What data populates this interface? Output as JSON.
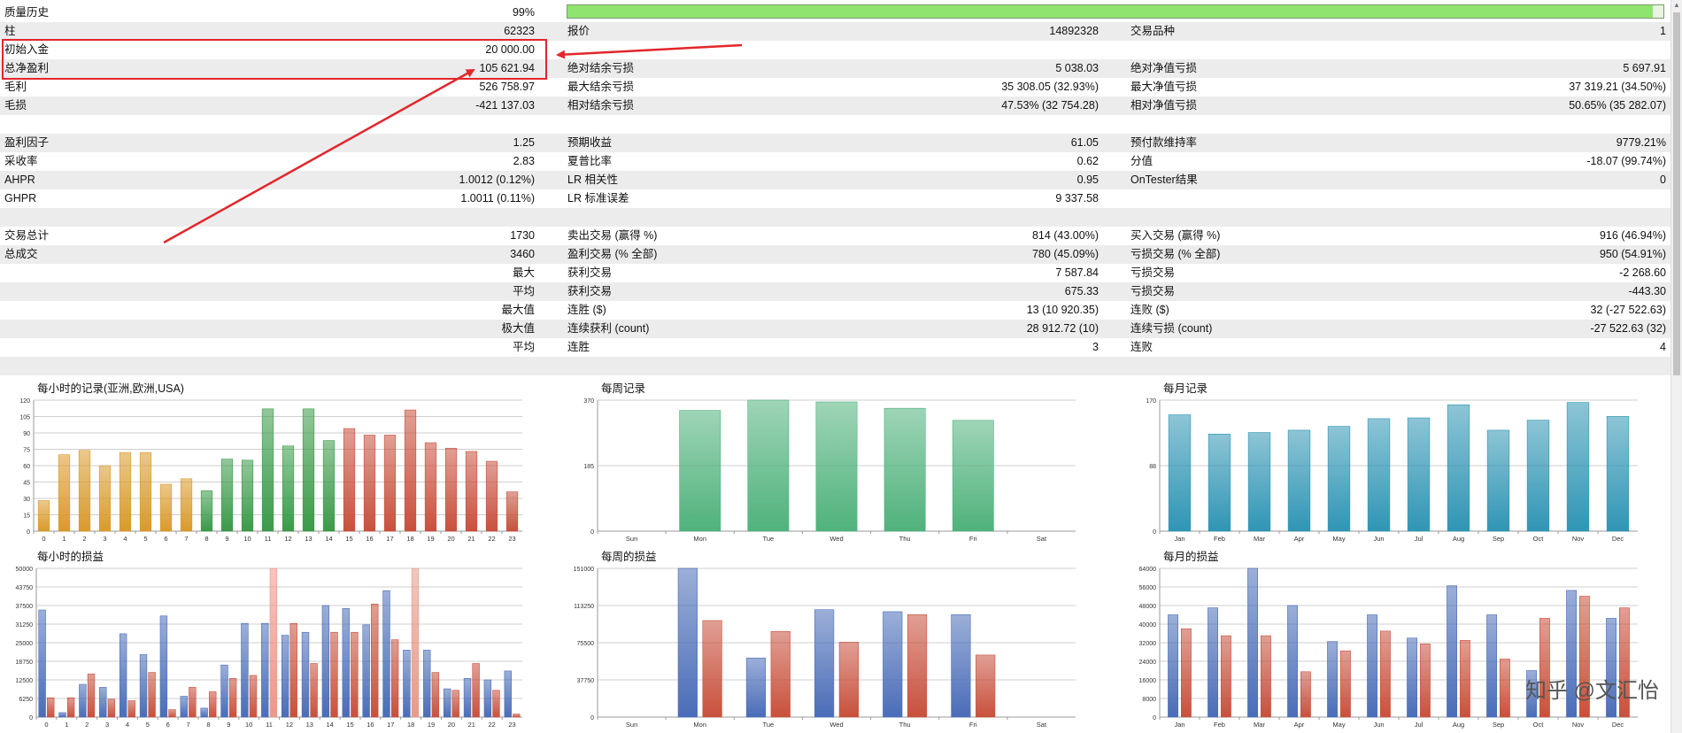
{
  "report": {
    "rows": [
      [
        [
          "质量历史",
          "99%"
        ],
        null,
        null
      ],
      [
        [
          "柱",
          "62323"
        ],
        [
          "报价",
          "14892328"
        ],
        [
          "交易品种",
          "1"
        ]
      ],
      [
        [
          "初始入金",
          "20 000.00"
        ],
        null,
        null
      ],
      [
        [
          "总净盈利",
          "105 621.94"
        ],
        [
          "绝对结余亏损",
          "5 038.03"
        ],
        [
          "绝对净值亏损",
          "5 697.91"
        ]
      ],
      [
        [
          "毛利",
          "526 758.97"
        ],
        [
          "最大结余亏损",
          "35 308.05 (32.93%)"
        ],
        [
          "最大净值亏损",
          "37 319.21 (34.50%)"
        ]
      ],
      [
        [
          "毛损",
          "-421 137.03"
        ],
        [
          "相对结余亏损",
          "47.53% (32 754.28)"
        ],
        [
          "相对净值亏损",
          "50.65% (35 282.07)"
        ]
      ],
      null,
      [
        [
          "盈利因子",
          "1.25"
        ],
        [
          "预期收益",
          "61.05"
        ],
        [
          "预付款维持率",
          "9779.21%"
        ]
      ],
      [
        [
          "采收率",
          "2.83"
        ],
        [
          "夏普比率",
          "0.62"
        ],
        [
          "分值",
          "-18.07 (99.74%)"
        ]
      ],
      [
        [
          "AHPR",
          "1.0012 (0.12%)"
        ],
        [
          "LR 相关性",
          "0.95"
        ],
        [
          "OnTester结果",
          "0"
        ]
      ],
      [
        [
          "GHPR",
          "1.0011 (0.11%)"
        ],
        [
          "LR 标准误差",
          "9 337.58"
        ],
        null
      ],
      null,
      [
        [
          "交易总计",
          "1730"
        ],
        [
          "卖出交易 (赢得 %)",
          "814 (43.00%)"
        ],
        [
          "买入交易 (赢得 %)",
          "916 (46.94%)"
        ]
      ],
      [
        [
          "总成交",
          "3460"
        ],
        [
          "盈利交易 (% 全部)",
          "780 (45.09%)"
        ],
        [
          "亏损交易 (% 全部)",
          "950 (54.91%)"
        ]
      ],
      [
        [
          "",
          "最大"
        ],
        [
          "获利交易",
          "7 587.84"
        ],
        [
          "亏损交易",
          "-2 268.60"
        ]
      ],
      [
        [
          "",
          "平均"
        ],
        [
          "获利交易",
          "675.33"
        ],
        [
          "亏损交易",
          "-443.30"
        ]
      ],
      [
        [
          "",
          "最大值"
        ],
        [
          "连胜 ($)",
          "13 (10 920.35)"
        ],
        [
          "连败 ($)",
          "32 (-27 522.63)"
        ]
      ],
      [
        [
          "",
          "极大值"
        ],
        [
          "连续获利 (count)",
          "28 912.72 (10)"
        ],
        [
          "连续亏损 (count)",
          "-27 522.63 (32)"
        ]
      ],
      [
        [
          "",
          "平均"
        ],
        [
          "连胜",
          "3"
        ],
        [
          "连败",
          "4"
        ]
      ],
      null
    ],
    "quality_fraction": 0.99
  },
  "colors": {
    "annotation_red": "#e3262b",
    "quality_fill": "#8fe36f",
    "orange": "#d99a2a",
    "green": "#3a9a48",
    "red": "#c8503c",
    "week_green": "#4fb27c",
    "month_teal": "#2f95b4",
    "blue": "#4a6db8",
    "loss_red": "#c8503c",
    "pink": "#e89a8a"
  },
  "charts": {
    "hourly_records": {
      "title": "每小时的记录(亚洲,欧洲,USA)",
      "categories": [
        "0",
        "1",
        "2",
        "3",
        "4",
        "5",
        "6",
        "7",
        "8",
        "9",
        "10",
        "11",
        "12",
        "13",
        "14",
        "15",
        "16",
        "17",
        "18",
        "19",
        "20",
        "21",
        "22",
        "23"
      ],
      "yticks": [
        "120",
        "105",
        "90",
        "75",
        "60",
        "45",
        "30",
        "15",
        "0"
      ],
      "ymax": 120,
      "values": [
        28,
        70,
        74,
        60,
        72,
        72,
        43,
        48,
        37,
        66,
        65,
        112,
        78,
        112,
        83,
        94,
        88,
        88,
        111,
        81,
        76,
        73,
        64,
        36
      ],
      "colors_by_index": [
        "orange",
        "orange",
        "orange",
        "orange",
        "orange",
        "orange",
        "orange",
        "orange",
        "green",
        "green",
        "green",
        "green",
        "green",
        "green",
        "green",
        "red",
        "red",
        "red",
        "red",
        "red",
        "red",
        "red",
        "red",
        "red"
      ]
    },
    "weekly_records": {
      "title": "每周记录",
      "categories": [
        "Sun",
        "Mon",
        "Tue",
        "Wed",
        "Thu",
        "Fri",
        "Sat"
      ],
      "yticks": [
        "370",
        "185",
        "0"
      ],
      "ymax": 370,
      "values": [
        0,
        341,
        370,
        365,
        347,
        313,
        0
      ]
    },
    "monthly_records": {
      "title": "每月记录",
      "categories": [
        "Jan",
        "Feb",
        "Mar",
        "Apr",
        "May",
        "Jun",
        "Jul",
        "Aug",
        "Sep",
        "Oct",
        "Nov",
        "Dec"
      ],
      "yticks": [
        "170",
        "88",
        "0"
      ],
      "ymax": 170,
      "values": [
        151,
        126,
        128,
        131,
        136,
        146,
        147,
        164,
        131,
        144,
        167,
        149
      ]
    },
    "hourly_pl": {
      "title": "每小时的损益",
      "categories": [
        "0",
        "1",
        "2",
        "3",
        "4",
        "5",
        "6",
        "7",
        "8",
        "9",
        "10",
        "11",
        "12",
        "13",
        "14",
        "15",
        "16",
        "17",
        "18",
        "19",
        "20",
        "21",
        "22",
        "23"
      ],
      "yticks": [
        "50000",
        "43750",
        "37500",
        "31250",
        "25000",
        "18750",
        "12500",
        "6250",
        "0"
      ],
      "ymax": 50000,
      "profit": [
        36000,
        1500,
        11000,
        10000,
        28000,
        21000,
        34000,
        7000,
        3000,
        17500,
        31500,
        31500,
        27500,
        28500,
        37500,
        36500,
        31000,
        42500,
        22500,
        22500,
        9500,
        13000,
        12500,
        15500
      ],
      "loss": [
        6500,
        6500,
        14500,
        6000,
        5500,
        15000,
        2500,
        10000,
        8500,
        13000,
        14000,
        50000,
        31500,
        18000,
        28500,
        28500,
        38000,
        26000,
        50000,
        15000,
        9000,
        18000,
        9000,
        1000
      ]
    },
    "weekly_pl": {
      "title": "每周的损益",
      "categories": [
        "Sun",
        "Mon",
        "Tue",
        "Wed",
        "Thu",
        "Fri",
        "Sat"
      ],
      "yticks": [
        "151000",
        "113250",
        "75500",
        "37750",
        "0"
      ],
      "ymax": 151000,
      "profit": [
        0,
        151000,
        60000,
        109000,
        107000,
        104000,
        0
      ],
      "loss": [
        0,
        98000,
        87000,
        76000,
        104000,
        63000,
        0
      ]
    },
    "monthly_pl": {
      "title": "每月的损益",
      "categories": [
        "Jan",
        "Feb",
        "Mar",
        "Apr",
        "May",
        "Jun",
        "Jul",
        "Aug",
        "Sep",
        "Oct",
        "Nov",
        "Dec"
      ],
      "yticks": [
        "64000",
        "56000",
        "48000",
        "40000",
        "32000",
        "24000",
        "16000",
        "8000",
        "0"
      ],
      "ymax": 64000,
      "profit": [
        44000,
        47000,
        64000,
        48000,
        32500,
        44000,
        34000,
        56500,
        44000,
        20000,
        54500,
        42500
      ],
      "loss": [
        38000,
        35000,
        35000,
        19500,
        28500,
        37000,
        31500,
        33000,
        25000,
        42500,
        52000,
        47000
      ]
    }
  },
  "watermark": "知乎 @文汇怡"
}
